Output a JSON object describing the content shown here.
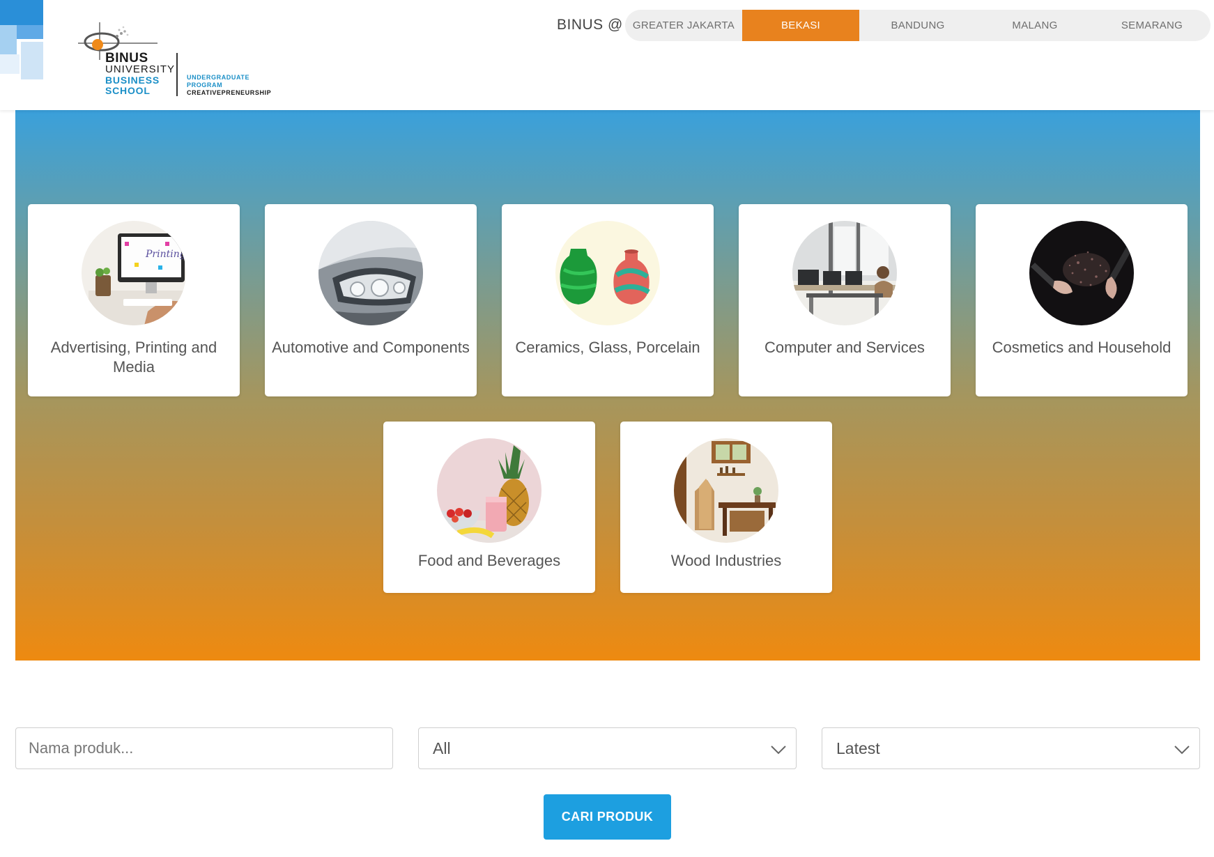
{
  "header": {
    "logo": {
      "brand": "BINUS",
      "university": "UNIVERSITY",
      "business": "BUSINESS",
      "school": "SCHOOL",
      "program_line1": "UNDERGRADUATE",
      "program_line2": "PROGRAM",
      "program_line3": "CREATIVEPRENEURSHIP"
    },
    "campus_label": "BINUS @",
    "campus_tabs": [
      {
        "label": "GREATER JAKARTA",
        "active": false
      },
      {
        "label": "BEKASI",
        "active": true
      },
      {
        "label": "BANDUNG",
        "active": false
      },
      {
        "label": "MALANG",
        "active": false
      },
      {
        "label": "SEMARANG",
        "active": false
      }
    ]
  },
  "categories": [
    {
      "label": "Advertising, Printing and Media",
      "icon": "printing-image-icon"
    },
    {
      "label": "Automotive and Components",
      "icon": "car-headlight-image-icon"
    },
    {
      "label": "Ceramics, Glass, Porcelain",
      "icon": "vases-image-icon"
    },
    {
      "label": "Computer and Services",
      "icon": "office-computers-image-icon"
    },
    {
      "label": "Cosmetics and Household",
      "icon": "makeup-brush-image-icon"
    },
    {
      "label": "Food and Beverages",
      "icon": "pineapple-smoothie-image-icon"
    },
    {
      "label": "Wood Industries",
      "icon": "wood-workshop-image-icon"
    }
  ],
  "search": {
    "placeholder": "Nama produk...",
    "category_select": "All",
    "sort_select": "Latest",
    "button_label": "CARI PRODUK"
  },
  "colors": {
    "accent_orange": "#e8821e",
    "button_blue": "#1d9fe0",
    "logo_blue": "#1b8fc7"
  }
}
